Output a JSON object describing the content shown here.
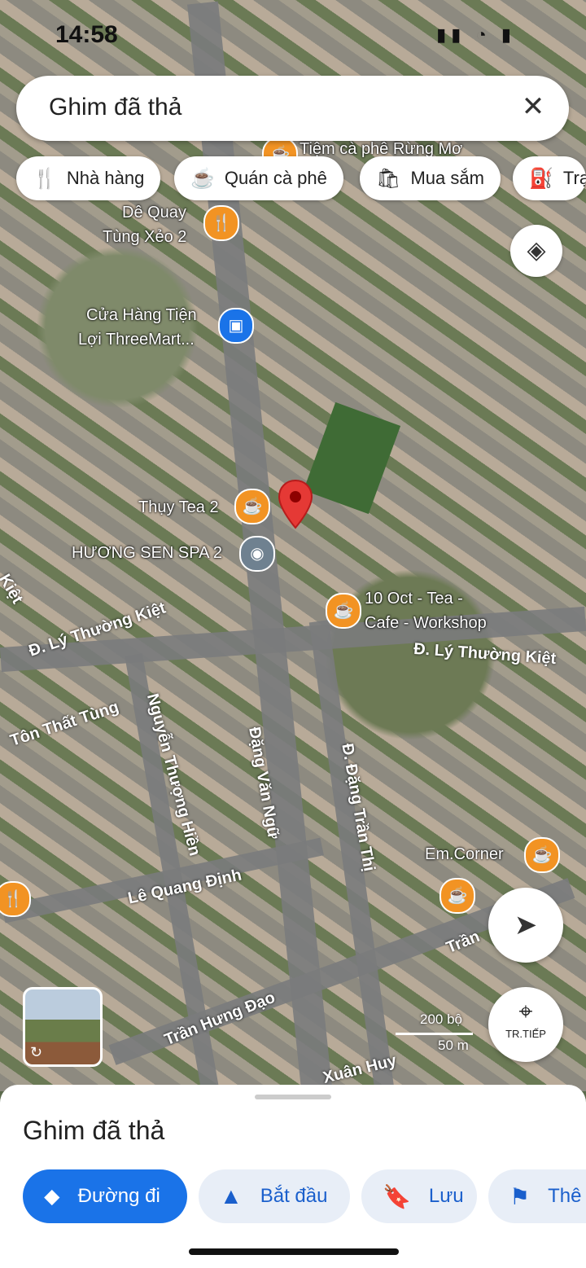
{
  "status_bar": {
    "time": "14:58",
    "icons": "▮▮ ◔ ▮"
  },
  "search": {
    "query": "Ghim đã thả",
    "close_icon": "✕"
  },
  "chips": [
    {
      "icon": "🍴",
      "label": "Nhà hàng"
    },
    {
      "icon": "☕",
      "label": "Quán cà phê"
    },
    {
      "icon": "🛍",
      "label": "Mua sắm"
    },
    {
      "icon": "⛽",
      "label": "Trạ"
    }
  ],
  "map": {
    "labels": [
      "Tiệm cà phê Rừng Mơ",
      "Dê Quay",
      "Tùng Xẻo 2",
      "Cửa Hàng Tiện",
      "Lợi ThreeMart...",
      "Thụy Tea 2",
      "HƯƠNG SEN SPA 2",
      "10 Oct - Tea -",
      "Cafe - Workshop",
      "Em.Corner"
    ],
    "streets": [
      "Đ. Lý Thường Kiệt",
      "Đ. Lý Thường Kiệt",
      "Tôn Thất Tùng",
      "Nguyễn Thượng Hiền",
      "Đặng Văn Ngữ",
      "Đ. Đặng Trần Thị",
      "Lê Quang Định",
      "Trần Hưng Đạo",
      "Trần",
      "Xuân Huy",
      "Kiệt"
    ],
    "scale": {
      "top": "200 bộ",
      "bottom": "50 m"
    }
  },
  "buttons": {
    "layers_icon": "◈",
    "nav_icon": "➤",
    "tr_tiep_icon": "⌖",
    "tr_tiep_label": "TR.TIẾP",
    "street_view_icon": "↻"
  },
  "sheet": {
    "title": "Ghim đã thả",
    "actions": [
      {
        "icon": "⬥",
        "label": "Đường đi"
      },
      {
        "icon": "▲",
        "label": "Bắt đầu"
      },
      {
        "icon": "🔖",
        "label": "Lưu"
      },
      {
        "icon": "⚑",
        "label": "Thê"
      }
    ]
  },
  "colors": {
    "accent": "#1a73e8",
    "pin": "#e53935",
    "poi_orange": "#f29323"
  }
}
